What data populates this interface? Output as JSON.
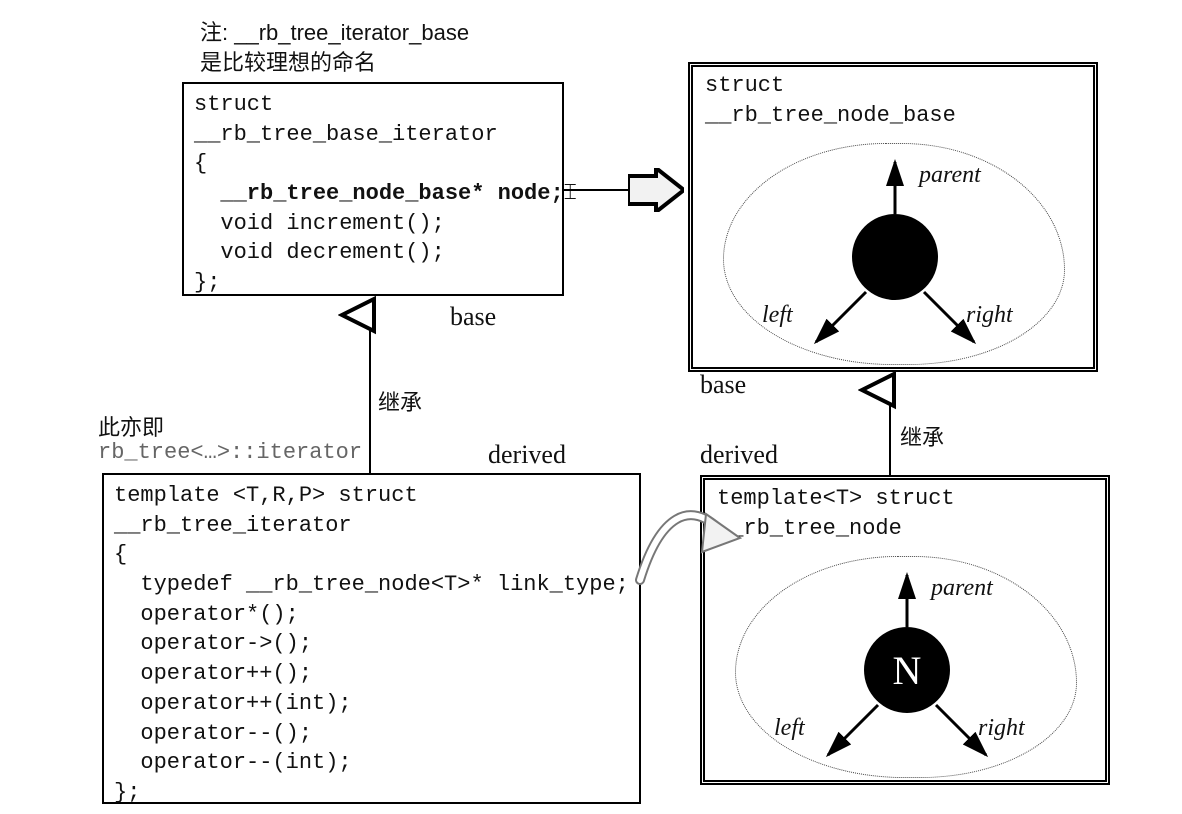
{
  "notes": {
    "top1": "注: __rb_tree_iterator_base",
    "top2": "  是比较理想的命名",
    "left1": "此亦即",
    "left2": "rb_tree<…>::iterator"
  },
  "boxes": {
    "baseIt": {
      "l1": "struct",
      "l2": "__rb_tree_base_iterator",
      "l3": "{",
      "l4": "  __rb_tree_node_base* node;",
      "l5": "  void increment();",
      "l6": "  void decrement();",
      "l7": "};",
      "insert": "⌶"
    },
    "derIt": {
      "l1": "template <T,R,P> struct",
      "l2": "__rb_tree_iterator",
      "l3": "{",
      "l4": "  typedef __rb_tree_node<T>* link_type;",
      "l5": "  operator*();",
      "l6": "  operator->();",
      "l7": "  operator++();",
      "l8": "  operator++(int);",
      "l9": "  operator--();",
      "l10": "  operator--(int);",
      "l11": "};"
    },
    "baseNode": {
      "l1": "struct",
      "l2": "__rb_tree_node_base"
    },
    "derNode": {
      "l1": "template<T> struct",
      "l2": "__rb_tree_node"
    }
  },
  "labels": {
    "base": "base",
    "derived": "derived",
    "inherit": "继承",
    "parent": "parent",
    "left": "left",
    "right": "right",
    "N": "N"
  }
}
